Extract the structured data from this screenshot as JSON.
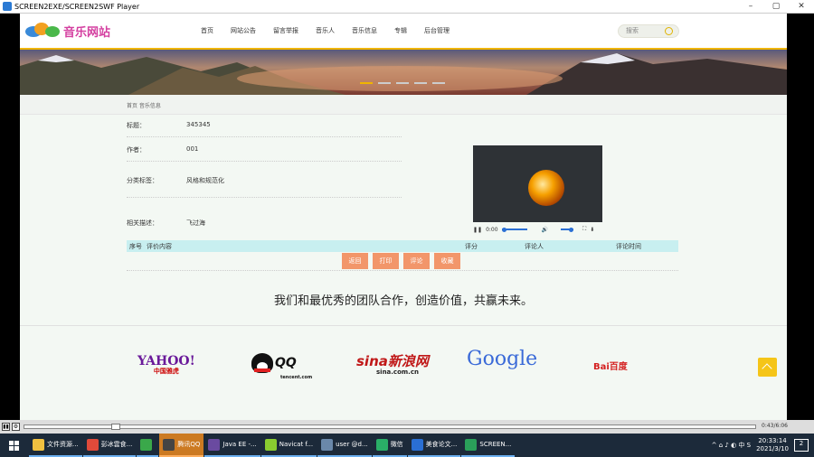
{
  "window": {
    "title": "SCREEN2EXE/SCREEN2SWF Player"
  },
  "site": {
    "logo_text": "音乐网站",
    "menu": [
      "首页",
      "网站公告",
      "留言举报",
      "音乐人",
      "音乐信息",
      "专辑",
      "后台管理"
    ],
    "search_placeholder": "搜索",
    "breadcrumb": "首页  音乐信息",
    "fields": [
      {
        "label": "标题：",
        "value": "345345"
      },
      {
        "label": "作者：",
        "value": "001"
      },
      {
        "label": "分类标签：",
        "value": "风格和规范化"
      },
      {
        "label": "相关描述：",
        "value": "飞过海"
      }
    ],
    "video": {
      "time": "0:00",
      "volume_level": 0.5,
      "progress": 0.0
    },
    "table_headers": [
      "序号",
      "评价内容",
      "评分",
      "评论人",
      "评论时间"
    ],
    "actions": [
      "返回",
      "打印",
      "评论",
      "收藏"
    ],
    "slogan": "我们和最优秀的团队合作，创造价值，共赢未来。",
    "partners": [
      "YAHOO!",
      "中国雅虎",
      "tencent.com",
      "sina新浪网",
      "sina.com.cn",
      "Google",
      "Bai百度"
    ],
    "colors": {
      "accent": "#f0b500",
      "button": "#f2966a",
      "table_header": "#c8eff0",
      "logo": "#d43fa0"
    }
  },
  "player": {
    "time": "0:43/6:06",
    "progress": 0.12
  },
  "taskbar": {
    "items": [
      {
        "label": "文件资源...",
        "color": "#f0c040"
      },
      {
        "label": "彭冰雲食...",
        "color": "#e04a3a"
      },
      {
        "label": "",
        "color": "#3aa84a"
      },
      {
        "label": "腾讯QQ",
        "color": "#444"
      },
      {
        "label": "Java EE -...",
        "color": "#6a4aa0"
      },
      {
        "label": "Navicat f...",
        "color": "#8acc30"
      },
      {
        "label": "user @d...",
        "color": "#6a88aa"
      },
      {
        "label": "微信",
        "color": "#2aae67"
      },
      {
        "label": "美食论文...",
        "color": "#2a6fd4"
      },
      {
        "label": "SCREEN...",
        "color": "#2aa05a"
      }
    ],
    "tray": "^ ⌂ ♪ ◐ 中 S",
    "time": "20:33:14",
    "date": "2021/3/10",
    "notify": "2"
  }
}
